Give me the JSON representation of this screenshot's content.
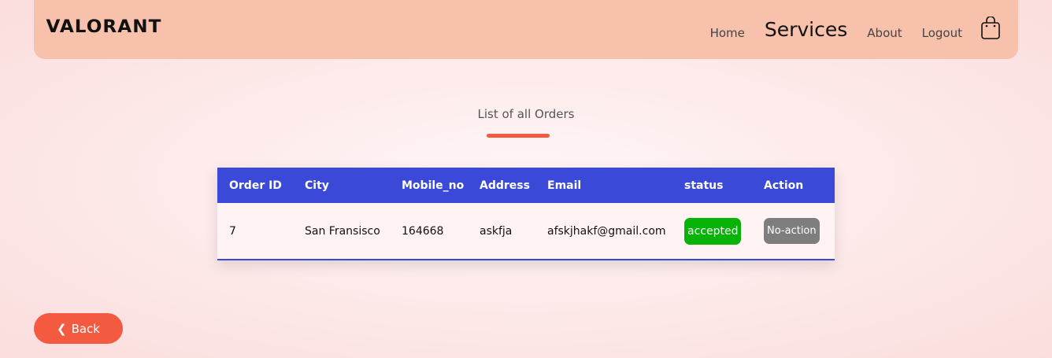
{
  "navbar": {
    "logo": "VALORANT",
    "links": {
      "home": "Home",
      "services": "Services",
      "about": "About",
      "logout": "Logout"
    },
    "cart_icon": "shopping-bag-icon"
  },
  "page": {
    "title": "List of all Orders",
    "accent_color": "#f45a40",
    "header_color": "#3b49d8"
  },
  "table": {
    "headers": {
      "order_id": "Order ID",
      "city": "City",
      "mobile": "Mobile_no",
      "address": "Address",
      "email": "Email",
      "status": "status",
      "action": "Action"
    },
    "rows": [
      {
        "order_id": "7",
        "city": "San Fransisco",
        "mobile": "164668",
        "address": "askfja",
        "email": "afskjhakf@gmail.com",
        "status": "accepted",
        "status_color": "#07b307",
        "action": "No-action"
      }
    ]
  },
  "back_button": {
    "icon": "❮",
    "label": "Back"
  }
}
